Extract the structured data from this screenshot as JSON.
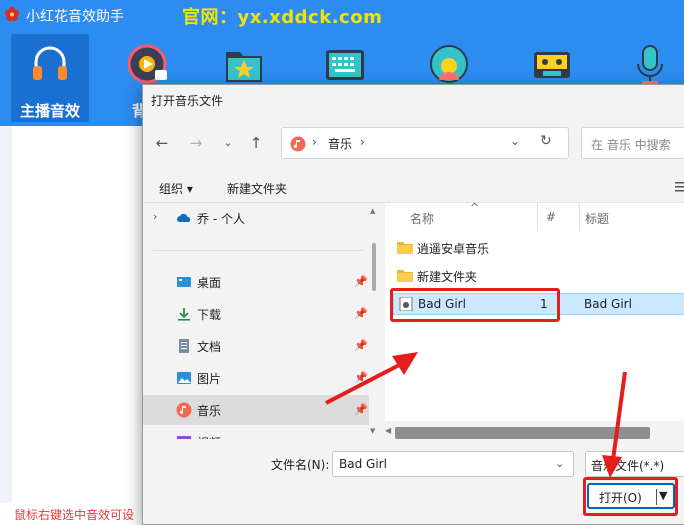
{
  "app": {
    "title": "小红花音效助手",
    "site": "官网：yx.xddck.com",
    "status_text": "鼠标右键选中音效可设",
    "toolbar": [
      {
        "label": "主播音效",
        "icon": "headphones-icon",
        "active": true
      },
      {
        "label": "背景",
        "icon": "music-disc-icon",
        "active": false
      },
      {
        "label": "",
        "icon": "star-folder-icon",
        "active": false
      },
      {
        "label": "",
        "icon": "keyboard-icon",
        "active": false
      },
      {
        "label": "",
        "icon": "avatar-icon",
        "active": false
      },
      {
        "label": "",
        "icon": "cassette-icon",
        "active": false
      },
      {
        "label": "",
        "icon": "microphone-icon",
        "active": false
      }
    ]
  },
  "dialog": {
    "title": "打开音乐文件",
    "address": {
      "folder": "音乐",
      "sep": "›"
    },
    "search_placeholder": "在 音乐 中搜索",
    "commands": {
      "organize": "组织 ▾",
      "new_folder": "新建文件夹"
    },
    "nav": [
      {
        "label": "乔 - 个人",
        "icon": "onedrive-icon",
        "pinned": false,
        "selected": false
      },
      {
        "label": "桌面",
        "icon": "desktop-icon",
        "pinned": true,
        "selected": false
      },
      {
        "label": "下载",
        "icon": "download-icon",
        "pinned": true,
        "selected": false
      },
      {
        "label": "文档",
        "icon": "document-icon",
        "pinned": true,
        "selected": false
      },
      {
        "label": "图片",
        "icon": "pictures-icon",
        "pinned": true,
        "selected": false
      },
      {
        "label": "音乐",
        "icon": "music-icon",
        "pinned": true,
        "selected": true
      },
      {
        "label": "视频",
        "icon": "video-icon",
        "pinned": false,
        "selected": false
      }
    ],
    "columns": {
      "name": "名称",
      "number": "#",
      "title": "标题"
    },
    "files": [
      {
        "name": "逍遥安卓音乐",
        "type": "folder",
        "number": "",
        "title": ""
      },
      {
        "name": "新建文件夹",
        "type": "folder",
        "number": "",
        "title": ""
      },
      {
        "name": "Bad Girl",
        "type": "audio",
        "number": "1",
        "title": "Bad Girl",
        "selected": true
      }
    ],
    "filename_label": "文件名(N):",
    "filename_value": "Bad Girl",
    "filetype_value": "音乐文件(*.*)",
    "open_label": "打开(O)"
  },
  "colors": {
    "app_blue": "#2d8cf0",
    "site_yellow": "#f6e200",
    "annotation_red": "#e41d1d",
    "selection_blue": "#cce8ff"
  }
}
